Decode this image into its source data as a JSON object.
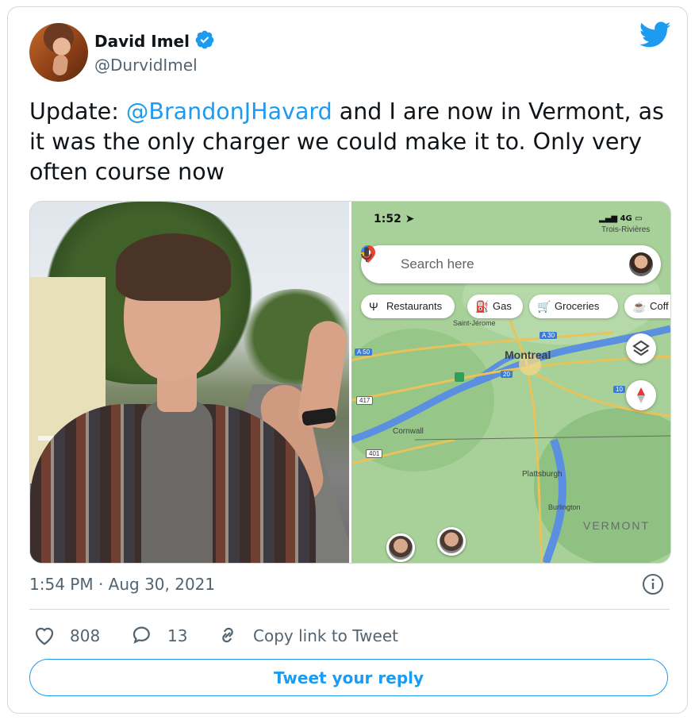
{
  "author": {
    "display_name": "David Imel",
    "handle": "@DurvidImel",
    "verified": true
  },
  "tweet": {
    "text_before": "Update: ",
    "mention": "@BrandonJHavard",
    "text_after": " and I are now in Vermont, as it was the only charger we could make it to. Only very often course now"
  },
  "media": {
    "photo": {
      "description_icon": "selfie-photo"
    },
    "map": {
      "status_time": "1:52",
      "status_right": "4G",
      "top_city": "Trois-Rivières",
      "search_placeholder": "Search here",
      "chips": [
        "Restaurants",
        "Gas",
        "Groceries",
        "Coff"
      ],
      "labels": {
        "saint_jerome": "Saint-Jérome",
        "montreal": "Montreal",
        "cornwall": "Cornwall",
        "plattsburgh": "Plattsburgh",
        "burlington": "Burlington",
        "vermont": "VERMONT",
        "a50": "A 50",
        "a30": "A 30",
        "r20": "20",
        "r10": "10",
        "r417": "417",
        "r401": "401"
      }
    }
  },
  "meta": {
    "timestamp": "1:54 PM · Aug 30, 2021"
  },
  "actions": {
    "likes": "808",
    "replies": "13",
    "copy_link": "Copy link to Tweet",
    "reply_button": "Tweet your reply"
  },
  "colors": {
    "accent": "#1d9bf0",
    "muted": "#536471",
    "border": "#cfd9de"
  }
}
